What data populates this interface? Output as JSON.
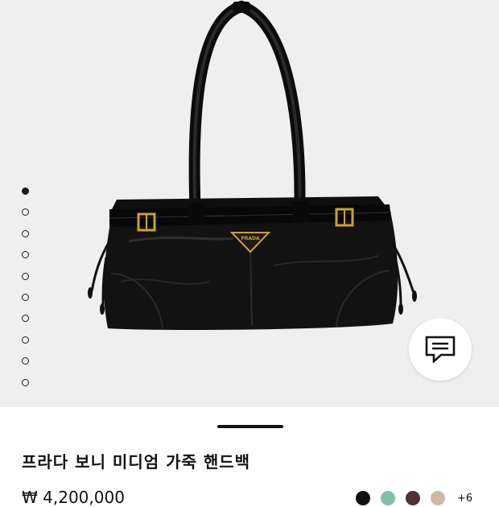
{
  "product": {
    "title": "프라다 보니 미디엄 가죽 핸드백",
    "price": "₩ 4,200,000",
    "more_colors": "+6"
  },
  "gallery": {
    "image_count": 10,
    "active_index": 0,
    "logo_text": "PRADA"
  },
  "swatches": [
    {
      "name": "black",
      "color": "#111111"
    },
    {
      "name": "green",
      "color": "#7fc2a6"
    },
    {
      "name": "brown",
      "color": "#4a3434"
    },
    {
      "name": "beige",
      "color": "#cdb8a6"
    }
  ],
  "icons": {
    "chat": "chat-bubble-icon"
  }
}
